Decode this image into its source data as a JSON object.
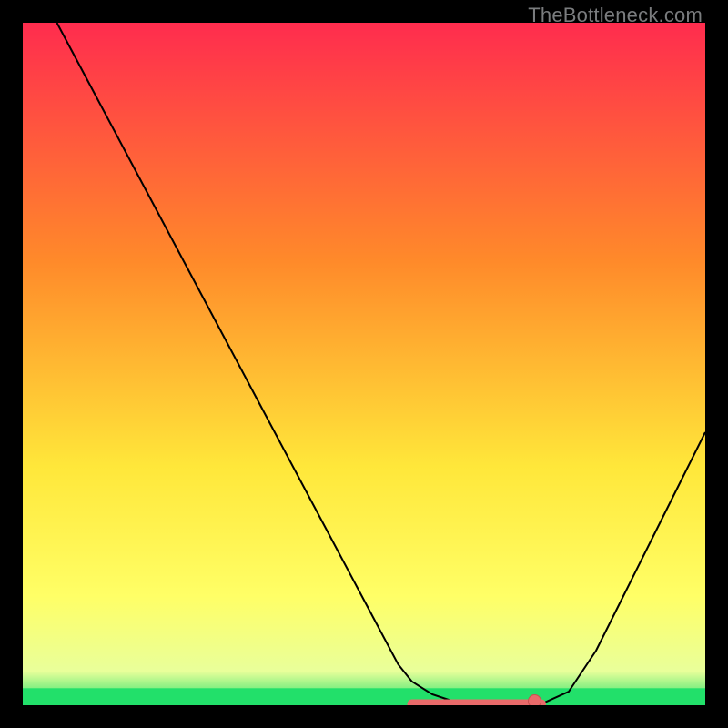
{
  "watermark": "TheBottleneck.com",
  "colors": {
    "black": "#000000",
    "curve": "#000000",
    "marker_fill": "#e96a6a",
    "marker_stroke": "#c94f4f",
    "gradient_top": "#ff2c4e",
    "gradient_mid1": "#ff8a2a",
    "gradient_mid2": "#ffe73a",
    "gradient_yellowmax": "#ffff66",
    "gradient_bottom_near": "#e9ff9a",
    "gradient_green": "#22e06a"
  },
  "chart_data": {
    "type": "line",
    "title": "",
    "xlabel": "",
    "ylabel": "",
    "xlim": [
      0,
      100
    ],
    "ylim": [
      0,
      100
    ],
    "x": [
      5,
      10,
      15,
      20,
      25,
      30,
      35,
      40,
      45,
      50,
      55,
      57,
      60,
      63,
      66,
      69,
      72,
      74,
      76,
      80,
      84,
      88,
      92,
      96,
      100
    ],
    "values": [
      100,
      90.6,
      81.2,
      71.8,
      62.4,
      53.0,
      43.6,
      34.2,
      24.8,
      15.4,
      6.0,
      3.5,
      1.6,
      0.6,
      0.2,
      0.0,
      0.0,
      0.0,
      0.2,
      2.0,
      8.0,
      16.0,
      24.0,
      32.0,
      40.0
    ],
    "flat_segment": {
      "x_start": 57,
      "x_end": 76,
      "y": 0.2
    },
    "markers": [
      {
        "x": 75,
        "y": 0.6
      }
    ],
    "green_band": {
      "y_start": 0,
      "y_end": 2.5
    }
  }
}
